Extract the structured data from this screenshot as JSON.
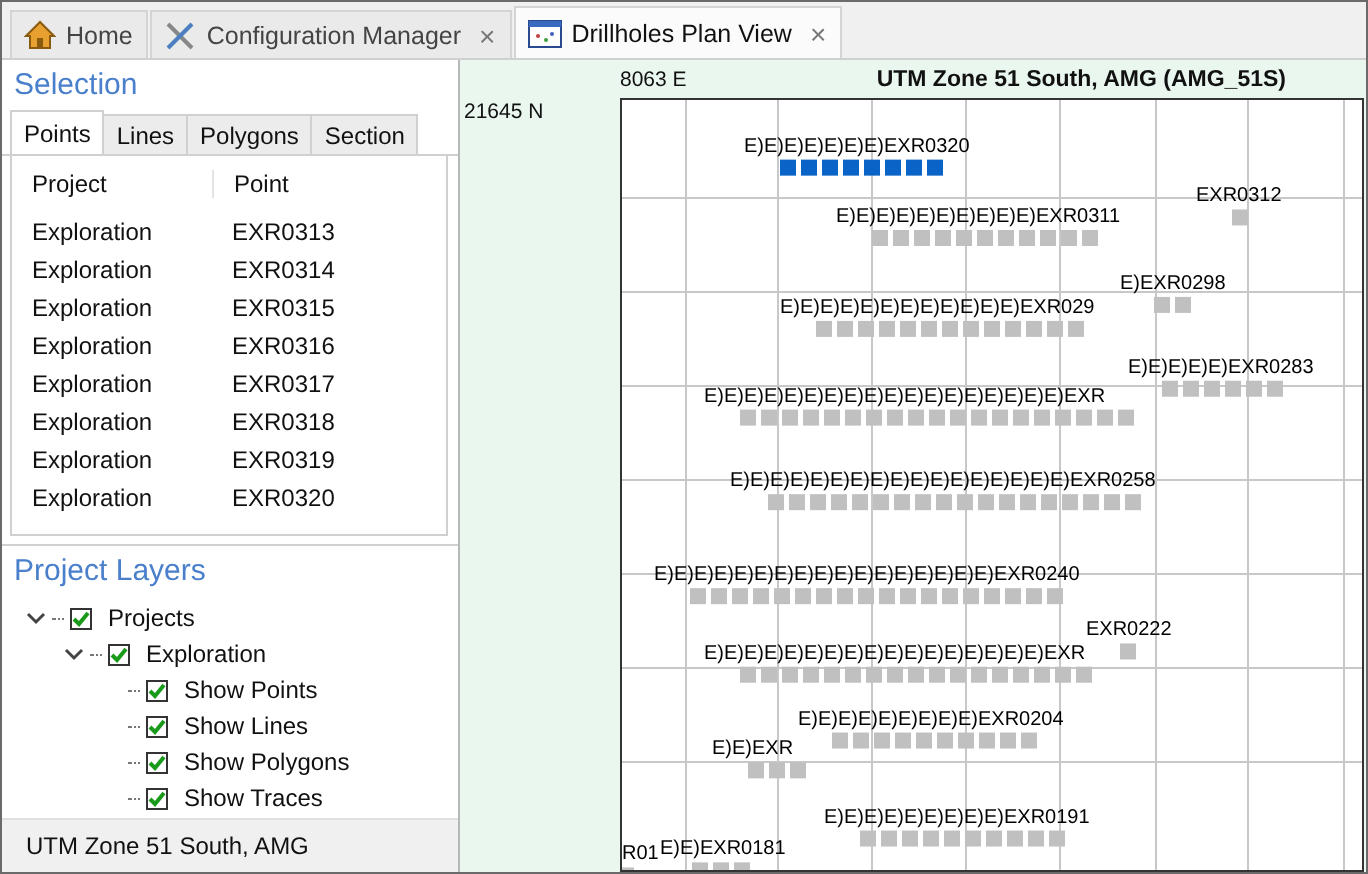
{
  "tabs": [
    {
      "kind": "home",
      "label": "Home",
      "selected": false
    },
    {
      "kind": "tools",
      "label": "Configuration Manager",
      "selected": false,
      "close": "×"
    },
    {
      "kind": "map",
      "label": "Drillholes Plan View",
      "selected": true,
      "close": "×"
    }
  ],
  "selection": {
    "title": "Selection",
    "tabs": [
      {
        "label": "Points",
        "selected": true
      },
      {
        "label": "Lines",
        "selected": false
      },
      {
        "label": "Polygons",
        "selected": false
      },
      {
        "label": "Section",
        "selected": false
      }
    ],
    "columns": [
      "Project",
      "Point"
    ],
    "rows": [
      [
        "Exploration",
        "EXR0313"
      ],
      [
        "Exploration",
        "EXR0314"
      ],
      [
        "Exploration",
        "EXR0315"
      ],
      [
        "Exploration",
        "EXR0316"
      ],
      [
        "Exploration",
        "EXR0317"
      ],
      [
        "Exploration",
        "EXR0318"
      ],
      [
        "Exploration",
        "EXR0319"
      ],
      [
        "Exploration",
        "EXR0320"
      ]
    ]
  },
  "layers": {
    "title": "Project Layers",
    "items": [
      {
        "label": "Projects",
        "checked": true,
        "expanded": true,
        "children": [
          {
            "label": "Exploration",
            "checked": true,
            "expanded": true,
            "children": [
              {
                "label": "Show Points",
                "checked": true
              },
              {
                "label": "Show Lines",
                "checked": true
              },
              {
                "label": "Show Polygons",
                "checked": true
              },
              {
                "label": "Show Traces",
                "checked": true
              }
            ]
          }
        ]
      }
    ]
  },
  "status_bar": "UTM Zone 51 South, AMG",
  "map": {
    "northing": "21645 N",
    "easting": "8063 E",
    "title": "UTM Zone 51 South, AMG (AMG_51S)",
    "points": [
      {
        "label": "E)E)E)E)E)E)E)EXR0320",
        "selected": true
      },
      {
        "label": "E)E)E)E)E)E)E)E)E)E)EXR0311",
        "selected": false
      },
      {
        "label": "EXR0312",
        "selected": false
      },
      {
        "label": "E)E)E)E)E)E)E)E)E)E)E)E)EXR029",
        "selected": false
      },
      {
        "label": "E)EXR0298",
        "selected": false
      },
      {
        "label": "E)E)E)E)E)E)E)E)E)E)E)E)E)E)E)E)E)E)EXR",
        "selected": false
      },
      {
        "label": "E)E)E)E)E)EXR0283",
        "selected": false
      },
      {
        "label": "E)E)E)E)E)E)E)E)E)E)E)E)E)E)E)E)E)EXR0258",
        "selected": false
      },
      {
        "label": "E)E)E)E)E)E)E)E)E)E)E)E)E)E)E)E)E)EXR0240",
        "selected": false
      },
      {
        "label": "E)E)E)E)E)E)E)E)E)E)E)E)E)E)E)E)E)EXR",
        "selected": false
      },
      {
        "label": "EXR0222",
        "selected": false
      },
      {
        "label": "E)E)EXR",
        "selected": false
      },
      {
        "label": "E)E)E)E)E)E)E)E)E)EXR0204",
        "selected": false
      },
      {
        "label": "R01",
        "selected": false
      },
      {
        "label": "E)E)EXR0181",
        "selected": false
      },
      {
        "label": "E)E)E)E)E)E)E)E)E)EXR0191",
        "selected": false
      }
    ]
  }
}
